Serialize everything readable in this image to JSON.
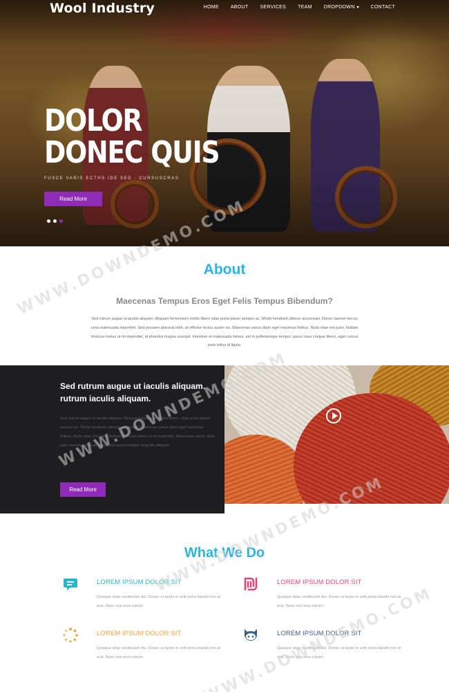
{
  "brand": {
    "name": "Wool Industry",
    "accent": "#8e2cb7",
    "heading_color": "#2ab3e3"
  },
  "nav": {
    "items": [
      "HOME",
      "ABOUT",
      "SERVICES",
      "TEAM",
      "DROPDOWN",
      "CONTACT"
    ]
  },
  "hero": {
    "title_line1": "DOLOR",
    "title_line2": "DONEC QUIS",
    "subtitle": "FUSCE VARIS ECTHS IDE SED - CURSUSCRAS",
    "button": "Read More",
    "slide_count": 3,
    "active_slide": 3
  },
  "about": {
    "title": "About",
    "subtitle": "Maecenas Tempus Eros Eget Felis Tempus Bibendum?",
    "body": "Sed rutrum augue ut iaculis aliquam. Aliquam fermentum mollis libero vitae porta ipsum semper ac. Morbi hendrerit ultrices accumsan. Donec laoreet leo eu urna malesuada imperdiet. Sed posuere placerat nibh, at efficitur lectus auctor eu. Maecenas varius diam eget maximus finibus. Nulla vitae est justo. Nullam rhoncus metus ut mi imperdiet, id pharetra magna suscipit. Interdum et malesuada fames. est in pellentesque tempor, purus risus congue libero, eget cursus justo tellus id ligula."
  },
  "feature_block": {
    "title": "Sed rutrum augue ut iaculis aliquam. rutrum iaculis aliquam.",
    "body": "Sed rutrum augue ut iaculis aliquam. Aliquam fermentum mollis libero, vitae porta ipsum semper ac. Morbi hendrerit ultrices accumsan.Maecenas varius diam eget maximus finibus. Nulla vitae est justo. Nullam rhoncus metus ut mi imperdiet. Maecenas varius diam eget maximus finibus vitae porta ipsumsemper acaculis aliquam.",
    "button": "Read More",
    "play_icon": "play-circle-icon"
  },
  "what_we_do": {
    "title": "What We Do",
    "items": [
      {
        "title": "LOREM IPSUM DOLOR SIT",
        "text": "Quisque vitae vestibulum dui. Donec ut turpis in velit porta blandit non at erat. Nunc non eros rutrum.",
        "icon": "chat-bubble-icon",
        "color": "#29b6c9"
      },
      {
        "title": "LOREM IPSUM DOLOR SIT",
        "text": "Quisque vitae vestibulum dui. Donec ut turpis in velit porta blandit non at erat. Nunc non eros rutrum.",
        "icon": "shekel-icon",
        "color": "#e0457a"
      },
      {
        "title": "LOREM IPSUM DOLOR SIT",
        "text": "Quisque vitae vestibulum dui. Donec ut turpis in velit porta blandit non at erat. Nunc non eros rutrum.",
        "icon": "spinner-icon",
        "color": "#f2a33c"
      },
      {
        "title": "LOREM IPSUM DOLOR SIT",
        "text": "Quisque vitae vestibulum dui. Donec ut turpis in velit porta blandit non at erat. Nunc non eros rutrum.",
        "icon": "github-icon",
        "color": "#3b5f8a"
      }
    ]
  },
  "watermark": "WWW.DOWNDEMO.COM"
}
